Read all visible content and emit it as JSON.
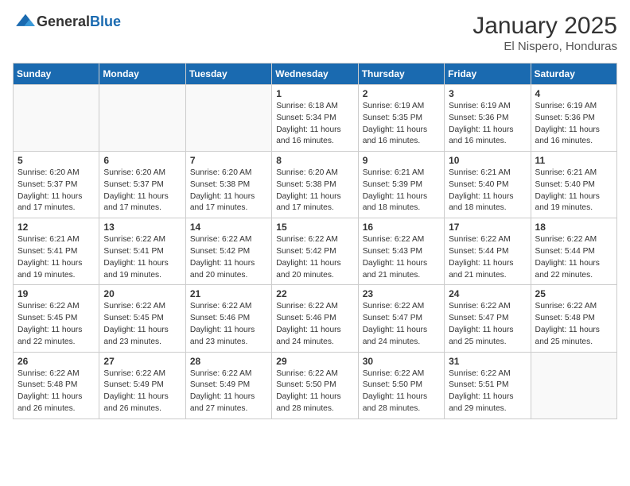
{
  "logo": {
    "general": "General",
    "blue": "Blue"
  },
  "title": "January 2025",
  "location": "El Nispero, Honduras",
  "days_header": [
    "Sunday",
    "Monday",
    "Tuesday",
    "Wednesday",
    "Thursday",
    "Friday",
    "Saturday"
  ],
  "weeks": [
    [
      {
        "num": "",
        "sunrise": "",
        "sunset": "",
        "daylight": ""
      },
      {
        "num": "",
        "sunrise": "",
        "sunset": "",
        "daylight": ""
      },
      {
        "num": "",
        "sunrise": "",
        "sunset": "",
        "daylight": ""
      },
      {
        "num": "1",
        "sunrise": "Sunrise: 6:18 AM",
        "sunset": "Sunset: 5:34 PM",
        "daylight": "Daylight: 11 hours and 16 minutes."
      },
      {
        "num": "2",
        "sunrise": "Sunrise: 6:19 AM",
        "sunset": "Sunset: 5:35 PM",
        "daylight": "Daylight: 11 hours and 16 minutes."
      },
      {
        "num": "3",
        "sunrise": "Sunrise: 6:19 AM",
        "sunset": "Sunset: 5:36 PM",
        "daylight": "Daylight: 11 hours and 16 minutes."
      },
      {
        "num": "4",
        "sunrise": "Sunrise: 6:19 AM",
        "sunset": "Sunset: 5:36 PM",
        "daylight": "Daylight: 11 hours and 16 minutes."
      }
    ],
    [
      {
        "num": "5",
        "sunrise": "Sunrise: 6:20 AM",
        "sunset": "Sunset: 5:37 PM",
        "daylight": "Daylight: 11 hours and 17 minutes."
      },
      {
        "num": "6",
        "sunrise": "Sunrise: 6:20 AM",
        "sunset": "Sunset: 5:37 PM",
        "daylight": "Daylight: 11 hours and 17 minutes."
      },
      {
        "num": "7",
        "sunrise": "Sunrise: 6:20 AM",
        "sunset": "Sunset: 5:38 PM",
        "daylight": "Daylight: 11 hours and 17 minutes."
      },
      {
        "num": "8",
        "sunrise": "Sunrise: 6:20 AM",
        "sunset": "Sunset: 5:38 PM",
        "daylight": "Daylight: 11 hours and 17 minutes."
      },
      {
        "num": "9",
        "sunrise": "Sunrise: 6:21 AM",
        "sunset": "Sunset: 5:39 PM",
        "daylight": "Daylight: 11 hours and 18 minutes."
      },
      {
        "num": "10",
        "sunrise": "Sunrise: 6:21 AM",
        "sunset": "Sunset: 5:40 PM",
        "daylight": "Daylight: 11 hours and 18 minutes."
      },
      {
        "num": "11",
        "sunrise": "Sunrise: 6:21 AM",
        "sunset": "Sunset: 5:40 PM",
        "daylight": "Daylight: 11 hours and 19 minutes."
      }
    ],
    [
      {
        "num": "12",
        "sunrise": "Sunrise: 6:21 AM",
        "sunset": "Sunset: 5:41 PM",
        "daylight": "Daylight: 11 hours and 19 minutes."
      },
      {
        "num": "13",
        "sunrise": "Sunrise: 6:22 AM",
        "sunset": "Sunset: 5:41 PM",
        "daylight": "Daylight: 11 hours and 19 minutes."
      },
      {
        "num": "14",
        "sunrise": "Sunrise: 6:22 AM",
        "sunset": "Sunset: 5:42 PM",
        "daylight": "Daylight: 11 hours and 20 minutes."
      },
      {
        "num": "15",
        "sunrise": "Sunrise: 6:22 AM",
        "sunset": "Sunset: 5:42 PM",
        "daylight": "Daylight: 11 hours and 20 minutes."
      },
      {
        "num": "16",
        "sunrise": "Sunrise: 6:22 AM",
        "sunset": "Sunset: 5:43 PM",
        "daylight": "Daylight: 11 hours and 21 minutes."
      },
      {
        "num": "17",
        "sunrise": "Sunrise: 6:22 AM",
        "sunset": "Sunset: 5:44 PM",
        "daylight": "Daylight: 11 hours and 21 minutes."
      },
      {
        "num": "18",
        "sunrise": "Sunrise: 6:22 AM",
        "sunset": "Sunset: 5:44 PM",
        "daylight": "Daylight: 11 hours and 22 minutes."
      }
    ],
    [
      {
        "num": "19",
        "sunrise": "Sunrise: 6:22 AM",
        "sunset": "Sunset: 5:45 PM",
        "daylight": "Daylight: 11 hours and 22 minutes."
      },
      {
        "num": "20",
        "sunrise": "Sunrise: 6:22 AM",
        "sunset": "Sunset: 5:45 PM",
        "daylight": "Daylight: 11 hours and 23 minutes."
      },
      {
        "num": "21",
        "sunrise": "Sunrise: 6:22 AM",
        "sunset": "Sunset: 5:46 PM",
        "daylight": "Daylight: 11 hours and 23 minutes."
      },
      {
        "num": "22",
        "sunrise": "Sunrise: 6:22 AM",
        "sunset": "Sunset: 5:46 PM",
        "daylight": "Daylight: 11 hours and 24 minutes."
      },
      {
        "num": "23",
        "sunrise": "Sunrise: 6:22 AM",
        "sunset": "Sunset: 5:47 PM",
        "daylight": "Daylight: 11 hours and 24 minutes."
      },
      {
        "num": "24",
        "sunrise": "Sunrise: 6:22 AM",
        "sunset": "Sunset: 5:47 PM",
        "daylight": "Daylight: 11 hours and 25 minutes."
      },
      {
        "num": "25",
        "sunrise": "Sunrise: 6:22 AM",
        "sunset": "Sunset: 5:48 PM",
        "daylight": "Daylight: 11 hours and 25 minutes."
      }
    ],
    [
      {
        "num": "26",
        "sunrise": "Sunrise: 6:22 AM",
        "sunset": "Sunset: 5:48 PM",
        "daylight": "Daylight: 11 hours and 26 minutes."
      },
      {
        "num": "27",
        "sunrise": "Sunrise: 6:22 AM",
        "sunset": "Sunset: 5:49 PM",
        "daylight": "Daylight: 11 hours and 26 minutes."
      },
      {
        "num": "28",
        "sunrise": "Sunrise: 6:22 AM",
        "sunset": "Sunset: 5:49 PM",
        "daylight": "Daylight: 11 hours and 27 minutes."
      },
      {
        "num": "29",
        "sunrise": "Sunrise: 6:22 AM",
        "sunset": "Sunset: 5:50 PM",
        "daylight": "Daylight: 11 hours and 28 minutes."
      },
      {
        "num": "30",
        "sunrise": "Sunrise: 6:22 AM",
        "sunset": "Sunset: 5:50 PM",
        "daylight": "Daylight: 11 hours and 28 minutes."
      },
      {
        "num": "31",
        "sunrise": "Sunrise: 6:22 AM",
        "sunset": "Sunset: 5:51 PM",
        "daylight": "Daylight: 11 hours and 29 minutes."
      },
      {
        "num": "",
        "sunrise": "",
        "sunset": "",
        "daylight": ""
      }
    ]
  ]
}
